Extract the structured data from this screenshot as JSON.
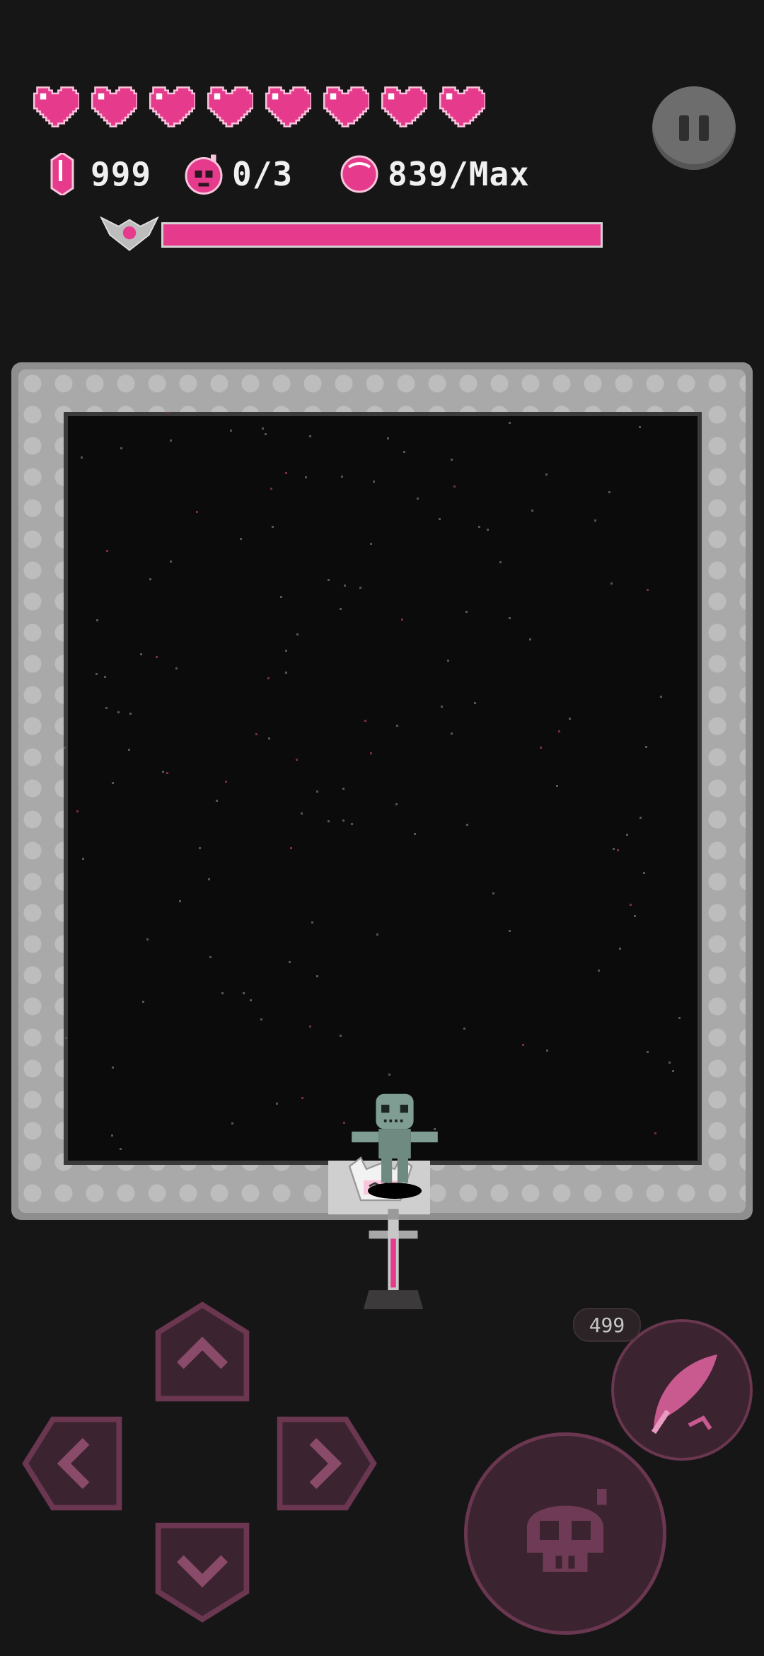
{
  "hud": {
    "hearts": {
      "count": 8,
      "icon": "heart-icon",
      "color": "#e63a8c"
    },
    "crystals": {
      "icon": "crystal-icon",
      "value": "999"
    },
    "bombs": {
      "icon": "bomb-skull-icon",
      "value": "0/3"
    },
    "orbs": {
      "icon": "orb-icon",
      "value": "839/Max"
    },
    "boss": {
      "icon": "winged-crest-icon",
      "health_fraction": 1.0,
      "bar_color": "#e63a8c"
    },
    "pause_icon": "pause-icon"
  },
  "arena": {
    "floor_color": "#0b0b0c",
    "wall_color": "#a9a9a9",
    "entities": [
      "voodoo-doll",
      "sword-in-stone",
      "door-creature"
    ]
  },
  "controls": {
    "dpad": [
      "up",
      "left",
      "right",
      "down"
    ],
    "skill": {
      "icon": "feather-quill-icon",
      "count": "499"
    },
    "attack": {
      "icon": "skull-bomb-icon"
    },
    "accent_color": "#6a3650"
  }
}
